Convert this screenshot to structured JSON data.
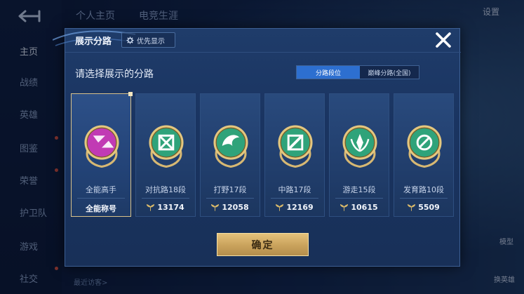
{
  "background": {
    "sidebar": [
      {
        "label": "主页",
        "active": true
      },
      {
        "label": "战绩",
        "active": false
      },
      {
        "label": "英雄",
        "active": false
      },
      {
        "label": "图鉴",
        "active": false
      },
      {
        "label": "荣誉",
        "active": false
      },
      {
        "label": "护卫队",
        "active": false
      },
      {
        "label": "游戏",
        "active": false
      },
      {
        "label": "社交",
        "active": false
      }
    ],
    "top_tabs": [
      "个人主页",
      "电竞生涯"
    ],
    "settings_label": "设置",
    "right_label_1": "模型",
    "right_label_2": "换英雄",
    "recent_label": "最近访客>"
  },
  "modal": {
    "title": "展示分路",
    "priority_button": "优先显示",
    "subtitle": "请选择展示的分路",
    "segment": [
      "分路段位",
      "巅峰分路(全国)"
    ],
    "segment_selected": 0,
    "confirm_label": "确定"
  },
  "cards": [
    {
      "label": "全能高手",
      "stat": "全能称号",
      "has_points": false,
      "selected": true,
      "badge": "all-round-badge-icon",
      "color": "#c13ab4"
    },
    {
      "label": "对抗路18段",
      "stat": "13174",
      "has_points": true,
      "selected": false,
      "badge": "clash-lane-badge-icon",
      "color": "#2fa37a"
    },
    {
      "label": "打野17段",
      "stat": "12058",
      "has_points": true,
      "selected": false,
      "badge": "jungle-badge-icon",
      "color": "#2fa37a"
    },
    {
      "label": "中路17段",
      "stat": "12169",
      "has_points": true,
      "selected": false,
      "badge": "mid-lane-badge-icon",
      "color": "#2fa37a"
    },
    {
      "label": "游走15段",
      "stat": "10615",
      "has_points": true,
      "selected": false,
      "badge": "roam-badge-icon",
      "color": "#2fa37a"
    },
    {
      "label": "发育路10段",
      "stat": "5509",
      "has_points": true,
      "selected": false,
      "badge": "farm-lane-badge-icon",
      "color": "#2fa37a"
    }
  ]
}
